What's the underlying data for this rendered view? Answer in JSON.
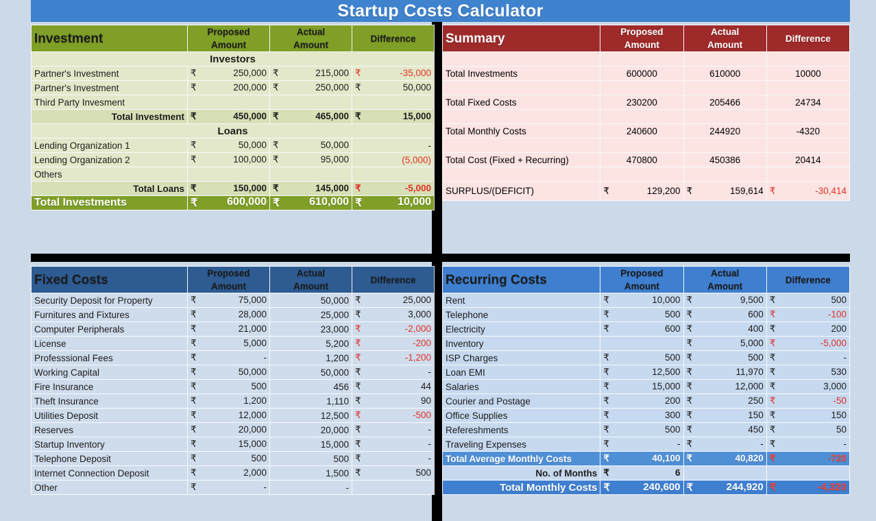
{
  "title": "Startup Costs Calculator",
  "currency": "₹",
  "columns": {
    "proposed": "Proposed\nAmount",
    "actual": "Actual\nAmount",
    "difference": "Difference",
    "proposed_l1": "Proposed",
    "proposed_l2": "Amount",
    "actual_l1": "Actual",
    "actual_l2": "Amount"
  },
  "investment": {
    "header": "Investment",
    "sections": [
      {
        "name": "Investors",
        "rows": [
          {
            "label": "Partner's Investment",
            "proposed": "250,000",
            "actual": "215,000",
            "difference": "-35,000",
            "neg": true
          },
          {
            "label": "Partner's Investment",
            "proposed": "200,000",
            "actual": "250,000",
            "difference": "50,000",
            "neg": false
          },
          {
            "label": "Third Party Invesment",
            "proposed": "",
            "actual": "",
            "difference": "",
            "neg": false
          }
        ],
        "total": {
          "label": "Total Investment",
          "proposed": "450,000",
          "actual": "465,000",
          "difference": "15,000",
          "neg": false
        }
      },
      {
        "name": "Loans",
        "rows": [
          {
            "label": "Lending Organization 1",
            "proposed": "50,000",
            "actual": "50,000",
            "difference": "-",
            "neg": false,
            "nocur": true
          },
          {
            "label": "Lending Organization 2",
            "proposed": "100,000",
            "actual": "95,000",
            "difference": "(5,000)",
            "neg": true,
            "nocur": true
          },
          {
            "label": "Others",
            "proposed": "",
            "actual": "",
            "difference": "",
            "neg": false
          }
        ],
        "total": {
          "label": "Total Loans",
          "proposed": "150,000",
          "actual": "145,000",
          "difference": "-5,000",
          "neg": true
        }
      }
    ],
    "grand": {
      "label": "Total Investments",
      "proposed": "600,000",
      "actual": "610,000",
      "difference": "10,000",
      "neg": false
    }
  },
  "summary": {
    "header": "Summary",
    "rows": [
      {
        "label": "Total Investments",
        "proposed": "600000",
        "actual": "610000",
        "difference": "10000",
        "style": "row-green"
      },
      {
        "label": "Total Fixed Costs",
        "proposed": "230200",
        "actual": "205466",
        "difference": "24734",
        "style": "row-steel"
      },
      {
        "label": "Total Monthly Costs",
        "proposed": "240600",
        "actual": "244920",
        "difference": "-4320",
        "style": "row-blue"
      },
      {
        "label": "Total Cost (Fixed + Recurring)",
        "proposed": "470800",
        "actual": "450386",
        "difference": "20414",
        "style": "row-navy"
      }
    ],
    "surplus": {
      "label": "SURPLUS/(DEFICIT)",
      "proposed": "129,200",
      "actual": "159,614",
      "difference": "-30,414"
    }
  },
  "fixed_costs": {
    "header": "Fixed Costs",
    "rows": [
      {
        "label": "Security Deposit for Property",
        "proposed": "75,000",
        "actual": "50,000",
        "difference": "25,000",
        "neg": false,
        "acur": false
      },
      {
        "label": "Furnitures and Fixtures",
        "proposed": "28,000",
        "actual": "25,000",
        "difference": "3,000",
        "neg": false,
        "acur": false
      },
      {
        "label": "Computer Peripherals",
        "proposed": "21,000",
        "actual": "23,000",
        "difference": "-2,000",
        "neg": true,
        "acur": false
      },
      {
        "label": "License",
        "proposed": "5,000",
        "actual": "5,200",
        "difference": "-200",
        "neg": true,
        "acur": false
      },
      {
        "label": "Professsional Fees",
        "proposed": "-",
        "actual": "1,200",
        "difference": "-1,200",
        "neg": true,
        "acur": false
      },
      {
        "label": "Working Capital",
        "proposed": "50,000",
        "actual": "50,000",
        "difference": "-",
        "neg": false,
        "acur": false
      },
      {
        "label": "Fire Insurance",
        "proposed": "500",
        "actual": "456",
        "difference": "44",
        "neg": false,
        "acur": false
      },
      {
        "label": "Theft Insurance",
        "proposed": "1,200",
        "actual": "1,110",
        "difference": "90",
        "neg": false,
        "acur": false
      },
      {
        "label": "Utilities Deposit",
        "proposed": "12,000",
        "actual": "12,500",
        "difference": "-500",
        "neg": true,
        "acur": false
      },
      {
        "label": "Reserves",
        "proposed": "20,000",
        "actual": "20,000",
        "difference": "-",
        "neg": false,
        "acur": false
      },
      {
        "label": "Startup Inventory",
        "proposed": "15,000",
        "actual": "15,000",
        "difference": "-",
        "neg": false,
        "acur": false
      },
      {
        "label": "Telephone Deposit",
        "proposed": "500",
        "actual": "500",
        "difference": "-",
        "neg": false,
        "acur": false
      },
      {
        "label": "Internet Connection Deposit",
        "proposed": "2,000",
        "actual": "1,500",
        "difference": "500",
        "neg": false,
        "acur": false
      },
      {
        "label": "Other",
        "proposed": "-",
        "actual": "-",
        "difference": "",
        "neg": false,
        "acur": false
      }
    ]
  },
  "recurring_costs": {
    "header": "Recurring Costs",
    "rows": [
      {
        "label": "Rent",
        "proposed": "10,000",
        "actual": "9,500",
        "difference": "500",
        "neg": false
      },
      {
        "label": "Telephone",
        "proposed": "500",
        "actual": "600",
        "difference": "-100",
        "neg": true
      },
      {
        "label": "Electricity",
        "proposed": "600",
        "actual": "400",
        "difference": "200",
        "neg": false
      },
      {
        "label": "Inventory",
        "proposed": "",
        "actual": "5,000",
        "difference": "-5,000",
        "neg": true
      },
      {
        "label": "ISP Charges",
        "proposed": "500",
        "actual": "500",
        "difference": "-",
        "neg": false
      },
      {
        "label": "Loan EMI",
        "proposed": "12,500",
        "actual": "11,970",
        "difference": "530",
        "neg": false
      },
      {
        "label": "Salaries",
        "proposed": "15,000",
        "actual": "12,000",
        "difference": "3,000",
        "neg": false
      },
      {
        "label": "Courier and Postage",
        "proposed": "200",
        "actual": "250",
        "difference": "-50",
        "neg": true
      },
      {
        "label": "Office Supplies",
        "proposed": "300",
        "actual": "150",
        "difference": "150",
        "neg": false
      },
      {
        "label": "Refereshments",
        "proposed": "500",
        "actual": "450",
        "difference": "50",
        "neg": false
      },
      {
        "label": "Traveling Expenses",
        "proposed": "-",
        "actual": "-",
        "difference": "-",
        "neg": false
      }
    ],
    "average_total": {
      "label": "Total Average Monthly Costs",
      "proposed": "40,100",
      "actual": "40,820",
      "difference": "-720",
      "neg": true
    },
    "months": {
      "label": "No. of Months",
      "value": "6"
    },
    "grand": {
      "label": "Total Monthly Costs",
      "proposed": "240,600",
      "actual": "244,920",
      "difference": "-4,320",
      "neg": true
    }
  }
}
